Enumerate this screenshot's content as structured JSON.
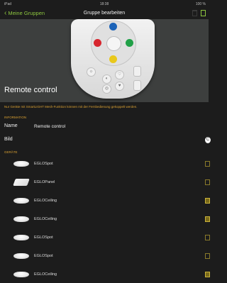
{
  "status": {
    "device": "iPad",
    "time": "18:38",
    "battery": "100 %"
  },
  "nav": {
    "back": "Meine Gruppen",
    "title": "Gruppe bearbeiten"
  },
  "hero": {
    "label": "Remote control"
  },
  "notice": "Nur Geräte mit SmartLIGHT Mesh-Funktion können mit der Fernbedienung gekoppelt werden.",
  "information": {
    "header": "INFORMATION",
    "name_label": "Name",
    "name_value": "Remote control",
    "bild_label": "Bild"
  },
  "devices": {
    "header": "GERÄTE",
    "items": [
      {
        "label": "EGLOSpot",
        "checked": false
      },
      {
        "label": "EGLOPanel",
        "checked": false
      },
      {
        "label": "EGLOCeiling",
        "checked": true
      },
      {
        "label": "EGLOCeiling",
        "checked": true
      },
      {
        "label": "EGLOSpot",
        "checked": false
      },
      {
        "label": "EGLOSpot",
        "checked": false
      },
      {
        "label": "EGLOCeiling",
        "checked": true
      }
    ]
  },
  "colors": {
    "accent": "#8dc63f",
    "section": "#d9a032"
  }
}
